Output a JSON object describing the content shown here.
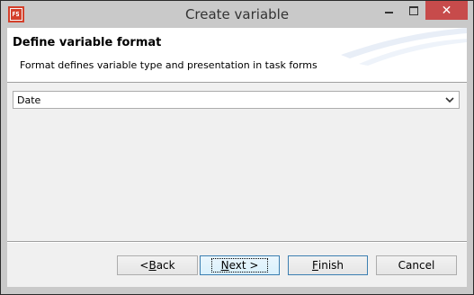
{
  "window": {
    "title": "Create variable"
  },
  "header": {
    "title": "Define variable format",
    "description": "Format defines variable type and presentation in task forms"
  },
  "format_select": {
    "value": "Date"
  },
  "buttons": {
    "back_prefix": "< ",
    "back_mnemonic": "B",
    "back_rest": "ack",
    "next_mnemonic": "N",
    "next_rest": "ext >",
    "finish_mnemonic": "F",
    "finish_rest": "inish",
    "cancel": "Cancel"
  },
  "icons": {
    "app": "app-icon",
    "minimize": "minimize-icon",
    "maximize": "maximize-icon",
    "close": "close-icon",
    "dropdown": "chevron-down-icon"
  }
}
